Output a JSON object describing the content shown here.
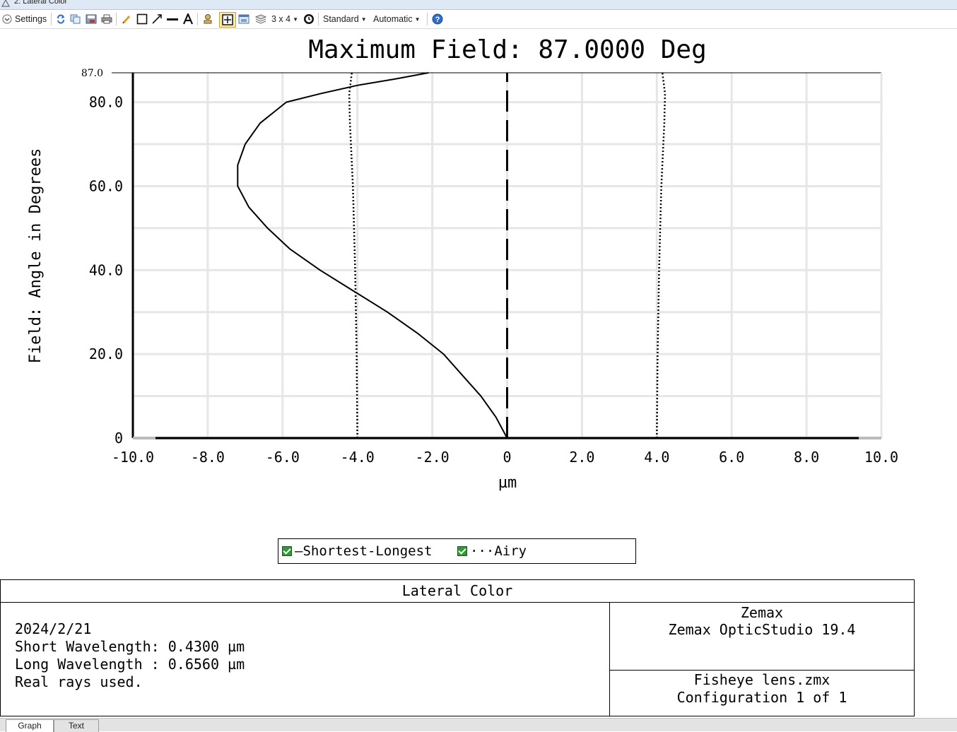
{
  "window": {
    "title": "2: Lateral Color"
  },
  "toolbar": {
    "settings_label": "Settings",
    "grid_label": "3 x 4",
    "standard_label": "Standard",
    "automatic_label": "Automatic",
    "icons": [
      "refresh-icon",
      "copy-icon",
      "save-icon",
      "print-icon",
      "pencil-icon",
      "rectangle-icon",
      "arrow-icon",
      "line-icon",
      "text-icon",
      "stamp-icon",
      "layout-icon",
      "window-icon",
      "layers-icon",
      "clock-icon",
      "help-icon"
    ]
  },
  "chart_data": {
    "type": "line",
    "title": "Maximum Field: 87.0000 Deg",
    "xlabel": "µm",
    "ylabel": "Field: Angle in Degrees",
    "xlim": [
      -10,
      10
    ],
    "ylim": [
      0,
      87
    ],
    "x_ticks": [
      "-10.0",
      "-8.0",
      "-6.0",
      "-4.0",
      "-2.0",
      "0",
      "2.0",
      "4.0",
      "6.0",
      "8.0",
      "10.0"
    ],
    "x_tick_values": [
      -10,
      -8,
      -6,
      -4,
      -2,
      0,
      2,
      4,
      6,
      8,
      10
    ],
    "y_ticks": [
      "0",
      "20.0",
      "40.0",
      "60.0",
      "80.0"
    ],
    "y_tick_values": [
      0,
      20,
      40,
      60,
      80
    ],
    "y_max_label": "87.0",
    "grid": true,
    "series": [
      {
        "name": "Shortest-Longest",
        "style": "solid",
        "x": [
          0,
          -0.3,
          -0.7,
          -1.2,
          -1.7,
          -2.4,
          -3.2,
          -4.1,
          -5.0,
          -5.8,
          -6.4,
          -6.9,
          -7.2,
          -7.2,
          -7.0,
          -6.6,
          -5.9,
          -5.0,
          -4.0,
          -3.0,
          -2.1
        ],
        "y": [
          0,
          5,
          10,
          15,
          20,
          25,
          30,
          35,
          40,
          45,
          50,
          55,
          60,
          65,
          70,
          75,
          80,
          82,
          84,
          85.5,
          87
        ]
      },
      {
        "name": "Airy",
        "style": "dotted",
        "x": [
          -4.0,
          -4.02,
          -4.06,
          -4.12,
          -4.2,
          -4.22,
          -4.15
        ],
        "y": [
          0,
          20,
          40,
          60,
          75,
          82,
          87
        ]
      },
      {
        "name": "Airy",
        "style": "dotted",
        "mirror": true,
        "x": [
          4.0,
          4.02,
          4.06,
          4.12,
          4.2,
          4.22,
          4.15
        ],
        "y": [
          0,
          20,
          40,
          60,
          75,
          82,
          87
        ]
      },
      {
        "name": "axis",
        "style": "dashed",
        "x": [
          0,
          0
        ],
        "y": [
          0,
          87
        ]
      }
    ],
    "colors": {
      "line": "#000000",
      "grid": "#e6e6e6"
    }
  },
  "legend": {
    "items": [
      {
        "label": "Shortest-Longest",
        "symbol": "—"
      },
      {
        "label": "Airy",
        "symbol": "···"
      }
    ]
  },
  "info": {
    "title": "Lateral Color",
    "date": "2024/2/21",
    "short_wavelength": "Short Wavelength: 0.4300 µm",
    "long_wavelength": "Long Wavelength : 0.6560 µm",
    "rays": "Real rays used.",
    "company": "Zemax",
    "product": "Zemax OpticStudio 19.4",
    "file": "Fisheye lens.zmx",
    "configuration": "Configuration 1 of 1"
  },
  "tabs": [
    "Graph",
    "Text"
  ]
}
